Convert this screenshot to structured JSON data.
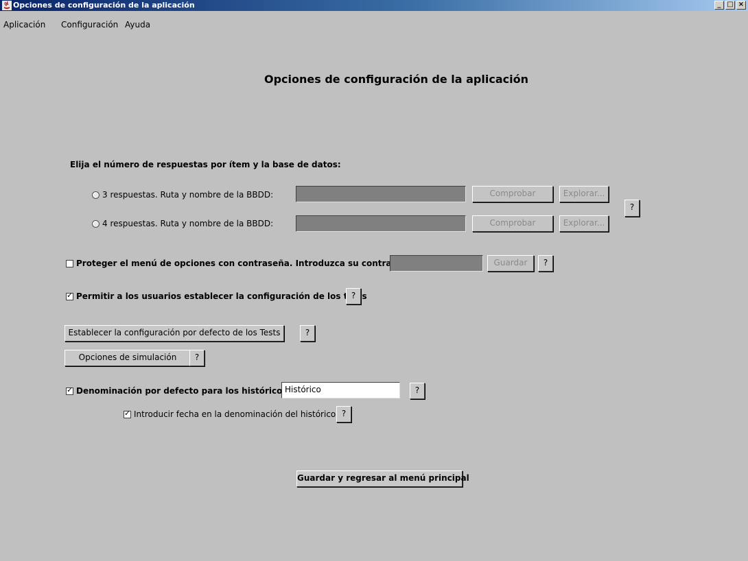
{
  "window": {
    "title": "Opciones de configuración de la aplicación",
    "minimize": "_",
    "maximize": "□",
    "close": "×"
  },
  "menu": {
    "items": [
      "Aplicación",
      "Configuración",
      "Ayuda"
    ]
  },
  "page": {
    "title": "Opciones de configuración de la aplicación",
    "section_label": "Elija el número de respuestas por ítem y la base de datos:"
  },
  "db_options": [
    {
      "label": "3 respuestas. Ruta y nombre de la BBDD:",
      "value": "",
      "check_label": "Comprobar",
      "browse_label": "Explorar...",
      "selected": false
    },
    {
      "label": "4 respuestas. Ruta y nombre de la BBDD:",
      "value": "",
      "check_label": "Comprobar",
      "browse_label": "Explorar...",
      "selected": false
    }
  ],
  "help_label": "?",
  "password": {
    "label": "Proteger el menú de opciones con contraseña. Introduzca su contraseña:",
    "checked": false,
    "save_label": "Guardar"
  },
  "allow_users": {
    "label": "Permitir a los usuarios establecer la configuración de los tests",
    "checked": true
  },
  "default_tests_button": "Establecer la configuración por defecto de los Tests",
  "simulation_button": "Opciones de simulación",
  "history": {
    "label": "Denominación por defecto para los históricos:",
    "checked": true,
    "value": "Histórico",
    "date_label": "Introducir fecha en la denominación del histórico",
    "date_checked": true
  },
  "save_return_button": "Guardar y regresar al menú principal"
}
